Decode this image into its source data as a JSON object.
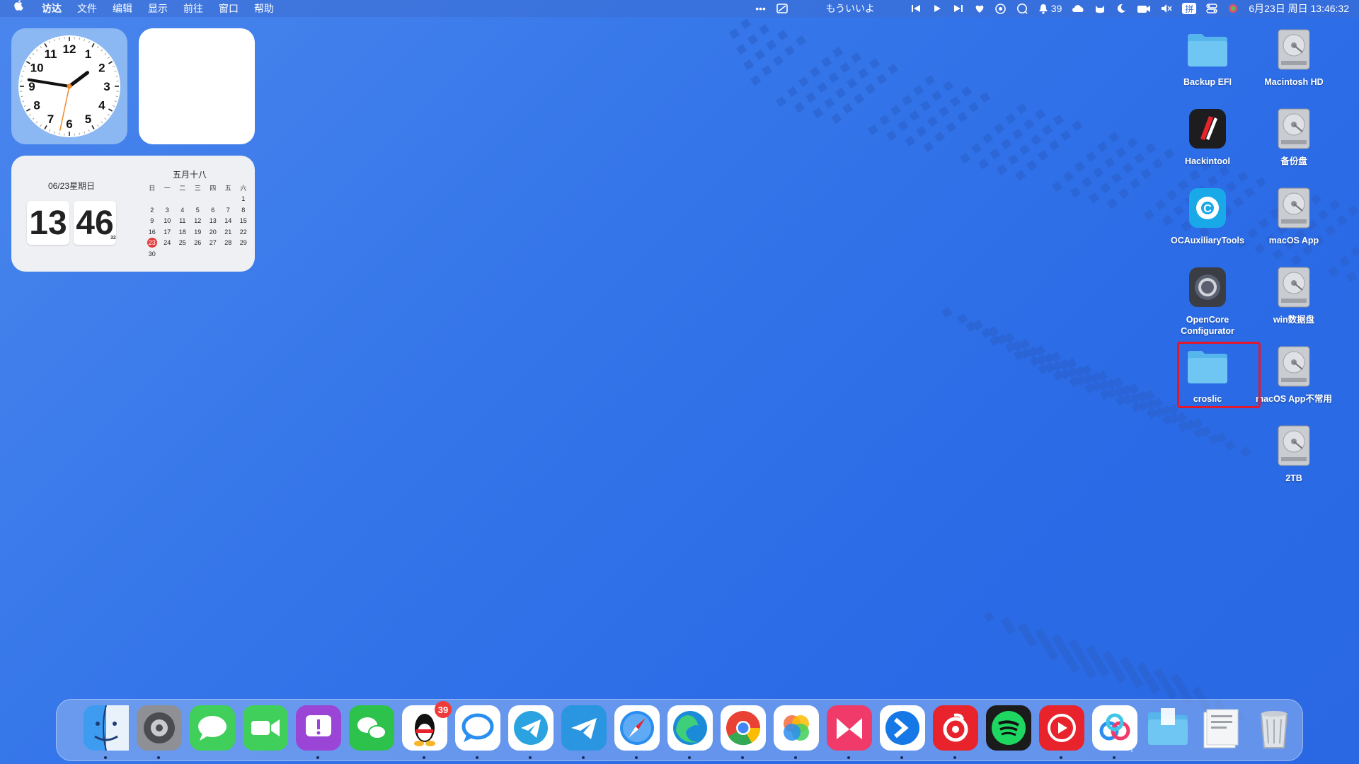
{
  "menubar": {
    "apple_icon": "apple-logo-icon",
    "app_name": "访达",
    "menus": [
      "文件",
      "编辑",
      "显示",
      "前往",
      "窗口",
      "帮助"
    ],
    "now_playing": "もういいよ",
    "notification_count": "39",
    "input_method": "拼",
    "datetime": "6月23日 周日 13:46:32"
  },
  "widgets": {
    "clock": {
      "hour": 13,
      "minute": 46,
      "second": 32,
      "numbers": [
        "12",
        "1",
        "2",
        "3",
        "4",
        "5",
        "6",
        "7",
        "8",
        "9",
        "10",
        "11"
      ]
    },
    "calendar": {
      "date_line": "06/23星期日",
      "hour": "13",
      "minute": "46",
      "seconds": "32",
      "lunar": "五月十八",
      "weekdays": [
        "日",
        "一",
        "二",
        "三",
        "四",
        "五",
        "六"
      ],
      "days": [
        "",
        "",
        "",
        "",
        "",
        "",
        "1",
        "2",
        "3",
        "4",
        "5",
        "6",
        "7",
        "8",
        "9",
        "10",
        "11",
        "12",
        "13",
        "14",
        "15",
        "16",
        "17",
        "18",
        "19",
        "20",
        "21",
        "22",
        "23",
        "24",
        "25",
        "26",
        "27",
        "28",
        "29",
        "30"
      ],
      "today": "23"
    }
  },
  "desktop": {
    "icons": [
      {
        "label": "Backup EFI",
        "kind": "folder"
      },
      {
        "label": "Macintosh HD",
        "kind": "disk"
      },
      {
        "label": "Hackintool",
        "kind": "app"
      },
      {
        "label": "备份盘",
        "kind": "disk"
      },
      {
        "label": "OCAuxiliaryTools",
        "kind": "app"
      },
      {
        "label": "macOS App",
        "kind": "disk"
      },
      {
        "label": "OpenCore Configurator",
        "kind": "app"
      },
      {
        "label": "win数据盘",
        "kind": "disk"
      },
      {
        "label": "croslic",
        "kind": "folder",
        "selected": true
      },
      {
        "label": "macOS App不常用",
        "kind": "disk"
      },
      {
        "label": "2TB",
        "kind": "disk"
      }
    ]
  },
  "dock": {
    "apps": [
      "finder-icon",
      "system-settings-icon",
      "messages-icon",
      "facetime-icon",
      "feedback-icon",
      "wechat-icon",
      "qq-icon",
      "chat-bubble-icon",
      "telegram-icon",
      "telegram-alt-icon",
      "safari-icon",
      "edge-icon",
      "chrome-icon",
      "photos-icon",
      "paw-icon",
      "teamviewer-icon",
      "netease-music-icon",
      "spotify-icon",
      "youtube-music-icon",
      "baidu-netdisk-icon",
      "downloads-folder-icon",
      "document-stack-icon",
      "trash-icon"
    ],
    "qq_badge": "39"
  }
}
